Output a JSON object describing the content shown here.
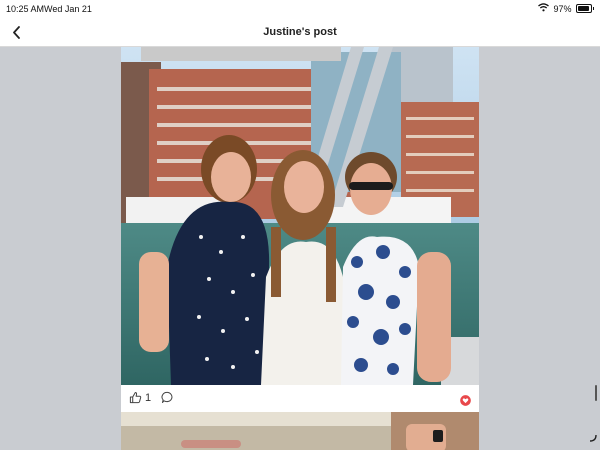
{
  "status_bar": {
    "time": "10:25 AM",
    "date": "Wed Jan 21",
    "battery": "97%",
    "battery_level": 0.97,
    "wifi_icon": "wifi-icon",
    "battery_icon": "battery-icon"
  },
  "nav": {
    "title": "Justine's post",
    "back_icon": "chevron-left-icon"
  },
  "post": {
    "photo_icon": "post-photo",
    "like_count": "1",
    "like_icon": "thumbs-up-icon",
    "comment_icon": "comment-bubble-icon",
    "favorite_icon": "heart-icon",
    "favorite_color": "#e8484b"
  },
  "next_post": {
    "photo_icon": "post-photo"
  },
  "colors": {
    "background": "#c9ccd1",
    "card": "#ffffff",
    "nav_bar": "#ffffff"
  }
}
